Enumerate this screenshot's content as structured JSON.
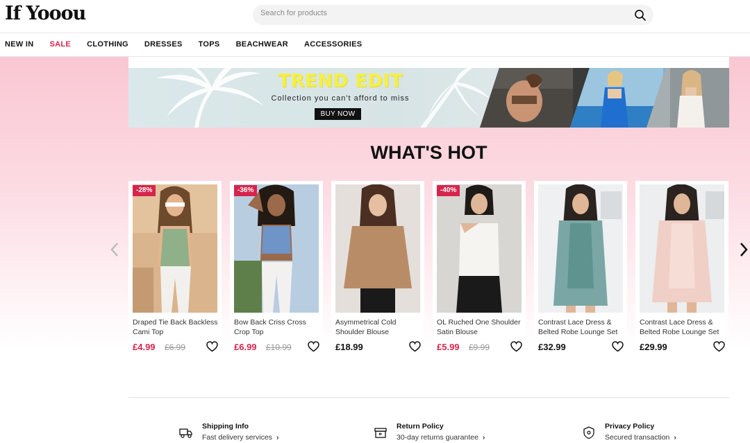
{
  "header": {
    "logo": "If Yooou",
    "search_placeholder": "Search for products"
  },
  "nav": {
    "items": [
      "NEW IN",
      "SALE",
      "CLOTHING",
      "DRESSES",
      "TOPS",
      "BEACHWEAR",
      "ACCESSORIES"
    ]
  },
  "banner": {
    "title": "TREND EDIT",
    "subtitle": "Collection you can't afford to miss",
    "button": "BUY NOW"
  },
  "section": {
    "title": "WHAT'S HOT"
  },
  "products": [
    {
      "badge": "-28%",
      "name": "Draped Tie Back Backless Cami Top",
      "price": "£4.99",
      "old_price": "£6.99"
    },
    {
      "badge": "-36%",
      "name": "Bow Back Criss Cross Crop Top",
      "price": "£6.99",
      "old_price": "£10.99"
    },
    {
      "badge": "",
      "name": "Asymmetrical Cold Shoulder Blouse",
      "price": "£18.99",
      "old_price": ""
    },
    {
      "badge": "-40%",
      "name": "OL Ruched One Shoulder Satin Blouse",
      "price": "£5.99",
      "old_price": "£9.99"
    },
    {
      "badge": "",
      "name": "Contrast Lace Dress & Belted Robe Lounge Set",
      "price": "£32.99",
      "old_price": ""
    },
    {
      "badge": "",
      "name": "Contrast Lace Dress & Belted Robe Lounge Set",
      "price": "£29.99",
      "old_price": ""
    }
  ],
  "footer": {
    "shipping": {
      "title": "Shipping Info",
      "subtitle": "Fast delivery services"
    },
    "returns": {
      "title": "Return Policy",
      "subtitle": "30-day returns guarantee"
    },
    "privacy": {
      "title": "Privacy Policy",
      "subtitle": "Secured transaction"
    }
  },
  "colors": {
    "accent": "#d6254d",
    "banner_title": "#f4ef4a",
    "page_gradient_top": "#fac7d2"
  },
  "icons": [
    "search-icon",
    "heart-icon",
    "chevron-left-icon",
    "chevron-right-icon",
    "truck-icon",
    "return-box-icon",
    "shield-icon"
  ]
}
